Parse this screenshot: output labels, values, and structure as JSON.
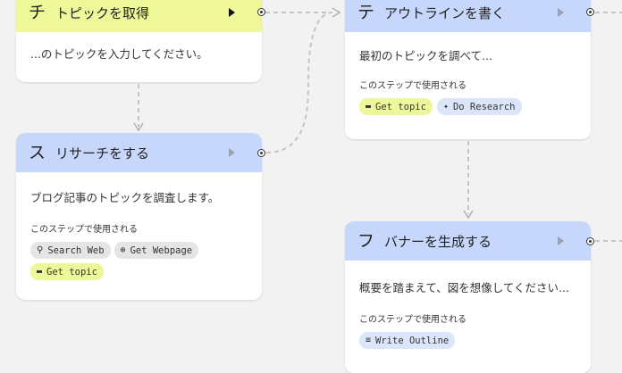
{
  "nodes": {
    "get_topic": {
      "icon": "チ",
      "title": "トピックを取得",
      "description": "...のトピックを入力してください。"
    },
    "research": {
      "icon": "ス",
      "title": "リサーチをする",
      "description": "ブログ記事のトピックを調査します。",
      "step_label": "このステップで使用される",
      "chips": [
        {
          "label": "Search Web",
          "icon": "search-icon",
          "glyph": "⚲",
          "color": "gray"
        },
        {
          "label": "Get Webpage",
          "icon": "globe-icon",
          "glyph": "⊕",
          "color": "gray"
        },
        {
          "label": "Get topic",
          "icon": "block-icon",
          "glyph": "▬",
          "color": "yellow"
        }
      ]
    },
    "outline": {
      "icon": "テ",
      "title": "アウトラインを書く",
      "description": "最初のトピックを調べて...",
      "step_label": "このステップで使用される",
      "chips": [
        {
          "label": "Get topic",
          "icon": "block-icon",
          "glyph": "▬",
          "color": "yellow"
        },
        {
          "label": "Do Research",
          "icon": "sparkle-icon",
          "glyph": "✦",
          "color": "blue"
        }
      ]
    },
    "banner": {
      "icon": "フ",
      "title": "バナーを生成する",
      "description": "概要を踏まえて、図を想像してください...",
      "step_label": "このステップで使用される",
      "chips": [
        {
          "label": "Write Outline",
          "icon": "list-icon",
          "glyph": "≡",
          "color": "blue"
        }
      ]
    }
  }
}
